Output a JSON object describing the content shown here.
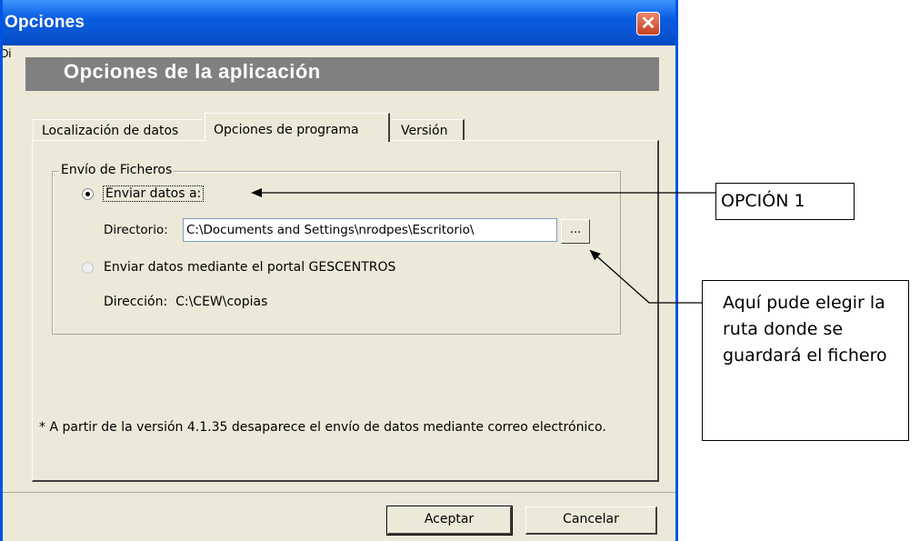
{
  "window": {
    "title": "Opciones",
    "cut_label": "Di...ción",
    "banner": "Opciones de la aplicación"
  },
  "tabs": [
    {
      "label": "Localización de datos"
    },
    {
      "label": "Opciones de programa",
      "selected": true
    },
    {
      "label": "Versión"
    }
  ],
  "group": {
    "legend": "Envío de Ficheros",
    "option1_label": "Enviar datos a:",
    "directory_label": "Directorio:",
    "directory_value": "C:\\Documents and Settings\\nrodpes\\Escritorio\\",
    "browse_label": "...",
    "option2_label": "Enviar datos mediante el portal GESCENTROS",
    "address_label": "Dirección:",
    "address_value": "C:\\CEW\\copias"
  },
  "note": "* A partir de la versión 4.1.35 desaparece el envío de datos mediante correo electrónico.",
  "buttons": {
    "accept": "Aceptar",
    "cancel": "Cancelar"
  },
  "callouts": {
    "option1": "OPCIÓN 1",
    "route": "Aquí pude elegir la ruta donde se guardará el fichero"
  }
}
